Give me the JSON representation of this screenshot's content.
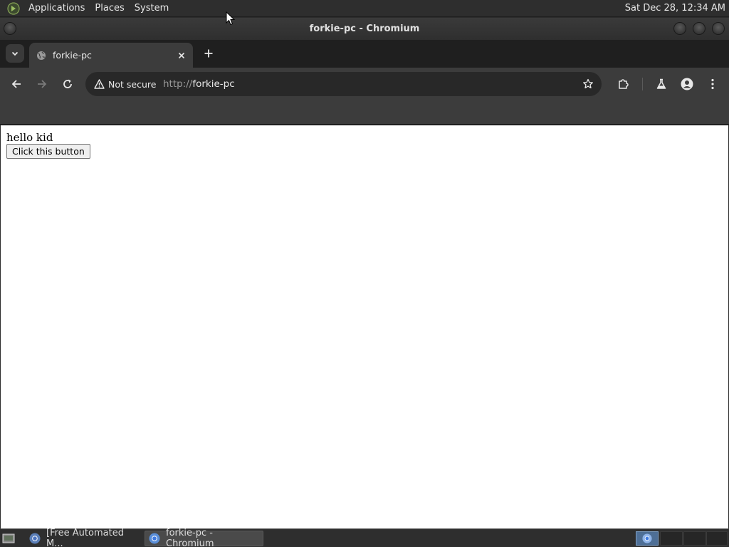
{
  "top_panel": {
    "menus": [
      "Applications",
      "Places",
      "System"
    ],
    "clock": "Sat Dec 28, 12:34 AM"
  },
  "window": {
    "title": "forkie-pc - Chromium"
  },
  "tabs": [
    {
      "title": "forkie-pc",
      "favicon": "globe-icon",
      "active": true
    }
  ],
  "toolbar": {
    "security_label": "Not secure",
    "url_scheme": "http://",
    "url_host": "forkie-pc"
  },
  "page": {
    "text": "hello kid",
    "button_label": "Click this button"
  },
  "taskbar": {
    "tasks": [
      {
        "label": "[Free Automated M...",
        "icon": "chromium-icon",
        "active": false
      },
      {
        "label": "forkie-pc - Chromium",
        "icon": "chromium-icon",
        "active": true
      }
    ]
  },
  "colors": {
    "panel_bg": "#2e2e2e",
    "toolbar_bg": "#3c3c3c",
    "omnibox_bg": "#282828",
    "workspace_active": "#4e6f96"
  }
}
